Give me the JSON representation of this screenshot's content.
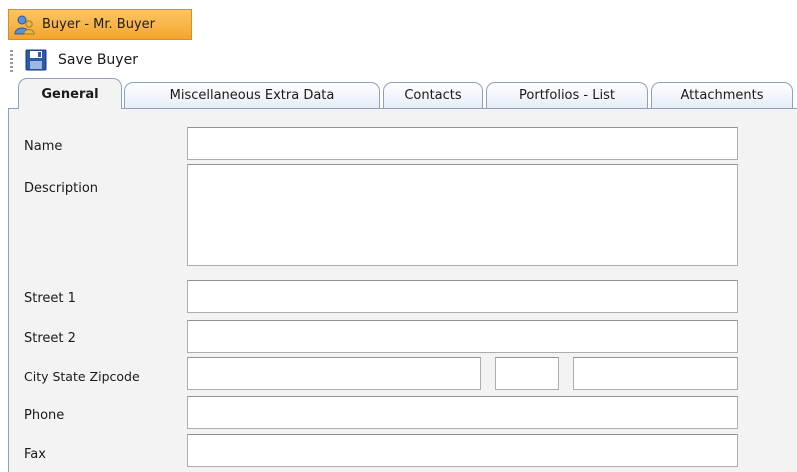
{
  "window": {
    "title": "Buyer - Mr. Buyer",
    "icon": "buyer-person-icon"
  },
  "toolbar": {
    "save_label": "Save Buyer",
    "save_icon": "floppy-disk-icon"
  },
  "tabs": [
    {
      "label": "General",
      "active": true
    },
    {
      "label": "Miscellaneous Extra Data",
      "active": false
    },
    {
      "label": "Contacts",
      "active": false
    },
    {
      "label": "Portfolios - List",
      "active": false
    },
    {
      "label": "Attachments",
      "active": false
    }
  ],
  "form": {
    "name": {
      "label": "Name",
      "value": ""
    },
    "description": {
      "label": "Description",
      "value": ""
    },
    "street1": {
      "label": "Street 1",
      "value": ""
    },
    "street2": {
      "label": "Street 2",
      "value": ""
    },
    "city_state_zip": {
      "label": "City State Zipcode",
      "city": "",
      "state": "",
      "zip": ""
    },
    "phone": {
      "label": "Phone",
      "value": ""
    },
    "fax": {
      "label": "Fax",
      "value": ""
    }
  },
  "colors": {
    "title_tab": "#f3a52d",
    "tab_border": "#8da2c0",
    "panel_bg": "#f3f3f3",
    "save_icon": "#2a5aa8"
  }
}
